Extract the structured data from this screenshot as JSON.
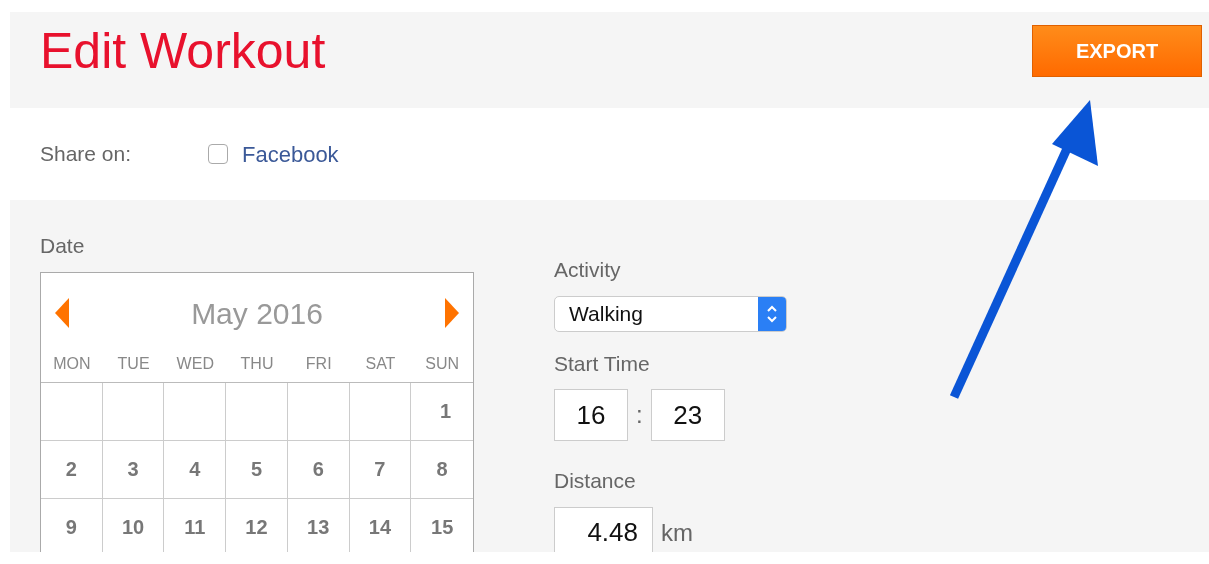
{
  "header": {
    "title": "Edit Workout",
    "export_button": "EXPORT"
  },
  "share": {
    "label": "Share on:",
    "options": [
      {
        "label": "Facebook",
        "checked": false
      }
    ]
  },
  "date": {
    "label": "Date",
    "calendar": {
      "month": "May 2016",
      "weekdays": [
        "MON",
        "TUE",
        "WED",
        "THU",
        "FRI",
        "SAT",
        "SUN"
      ],
      "weeks": [
        {
          "kind": "end",
          "days": [
            "1"
          ]
        },
        {
          "kind": "full",
          "days": [
            "2",
            "3",
            "4",
            "5",
            "6",
            "7",
            "8"
          ]
        },
        {
          "kind": "full",
          "days": [
            "9",
            "10",
            "11",
            "12",
            "13",
            "14",
            "15"
          ]
        }
      ]
    }
  },
  "activity": {
    "label": "Activity",
    "value": "Walking"
  },
  "start_time": {
    "label": "Start Time",
    "hours": "16",
    "separator": ":",
    "minutes": "23"
  },
  "distance": {
    "label": "Distance",
    "value": "4.48",
    "unit": "km"
  }
}
